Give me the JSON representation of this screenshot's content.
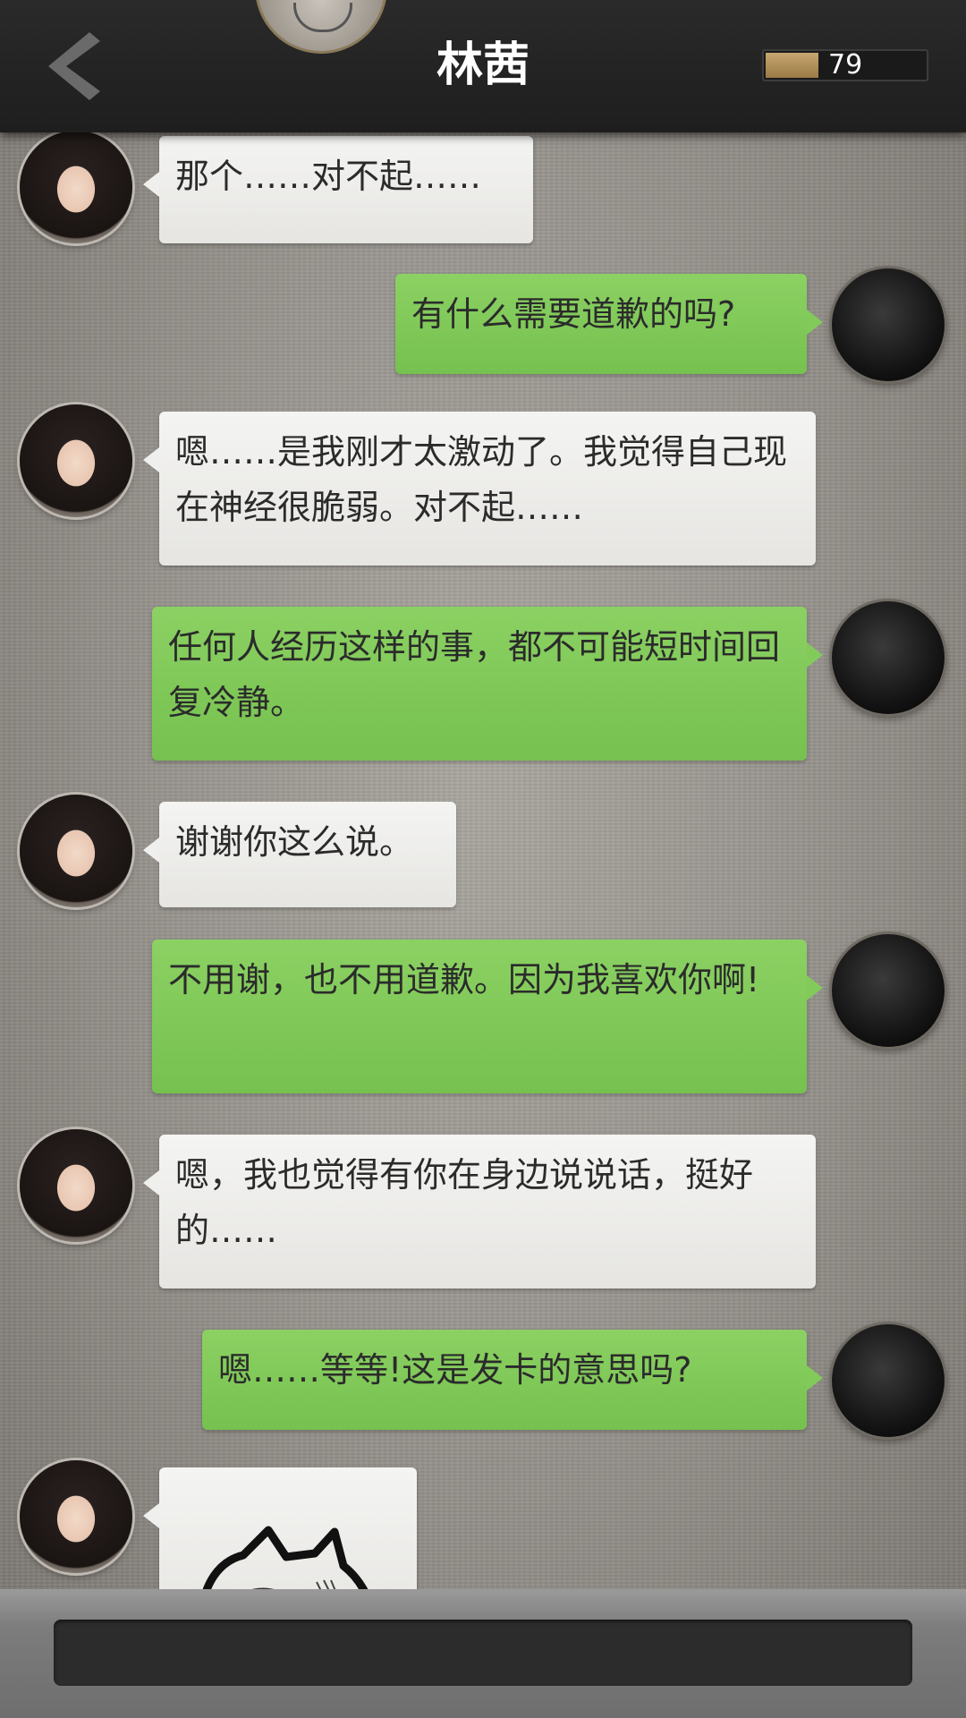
{
  "header": {
    "title": "林茜",
    "affection_value": "79",
    "affection_fraction": 0.33,
    "back_icon": "chevron-left-icon"
  },
  "messages": [
    {
      "side": "left",
      "text": "那个……对不起……"
    },
    {
      "side": "right",
      "text": "有什么需要道歉的吗?"
    },
    {
      "side": "left",
      "text": "嗯……是我刚才太激动了。我觉得自己现在神经很脆弱。对不起……"
    },
    {
      "side": "right",
      "text": "任何人经历这样的事，都不可能短时间回复冷静。"
    },
    {
      "side": "left",
      "text": "谢谢你这么说。"
    },
    {
      "side": "right",
      "text": "不用谢，也不用道歉。因为我喜欢你啊!"
    },
    {
      "side": "left",
      "text": "嗯，我也觉得有你在身边说说话，挺好的……"
    },
    {
      "side": "right",
      "text": "嗯……等等!这是发卡的意思吗?"
    },
    {
      "side": "left",
      "sticker": "cat-sticker"
    }
  ],
  "colors": {
    "header_bg": "#1e1e1e",
    "left_bubble": "#efefed",
    "right_bubble": "#82ca5a",
    "meter_fill": "#b8965e"
  }
}
